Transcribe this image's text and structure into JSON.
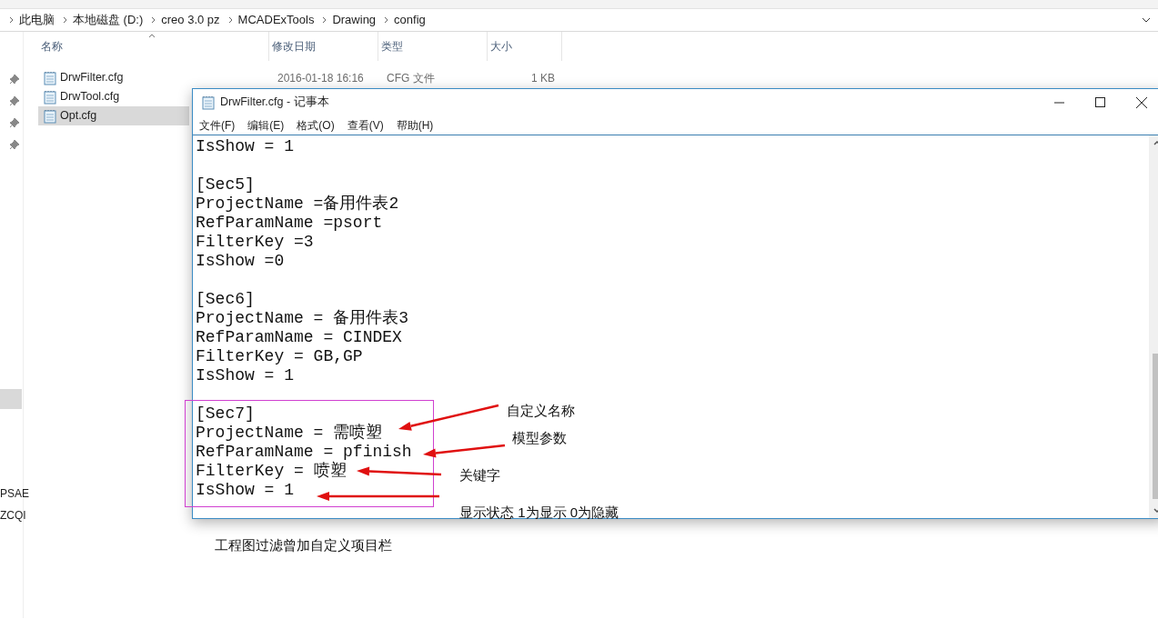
{
  "address_bar": {
    "crumbs": [
      "此电脑",
      "本地磁盘 (D:)",
      "creo 3.0 pz",
      "MCADExTools",
      "Drawing",
      "config"
    ]
  },
  "file_list": {
    "columns": [
      "名称",
      "修改日期",
      "类型",
      "大小"
    ],
    "rows": [
      {
        "name": "DrwFilter.cfg",
        "modified": "2016-01-18 16:16",
        "type": "CFG 文件",
        "size": "1 KB",
        "selected": false
      },
      {
        "name": "DrwTool.cfg",
        "selected": false
      },
      {
        "name": "Opt.cfg",
        "selected": true
      }
    ]
  },
  "nav_pane": {
    "cut_labels": [
      "PSAE",
      "ZCQI"
    ]
  },
  "notepad": {
    "title": "DrwFilter.cfg - 记事本",
    "menu": [
      "文件(F)",
      "编辑(E)",
      "格式(O)",
      "查看(V)",
      "帮助(H)"
    ],
    "sections": [
      [
        "IsShow = 1"
      ],
      [
        "[Sec5]",
        "ProjectName =备用件表2",
        "RefParamName =psort",
        "FilterKey =3",
        "IsShow =0"
      ],
      [
        "[Sec6]",
        "ProjectName = 备用件表3",
        "RefParamName = CINDEX",
        "FilterKey = GB,GP",
        "IsShow = 1"
      ],
      [
        "[Sec7]",
        "ProjectName = 需喷塑",
        "RefParamName = pfinish",
        "FilterKey = 喷塑",
        "IsShow = 1"
      ]
    ]
  },
  "annotations": [
    "自定义名称",
    "模型参数",
    "关键字",
    "显示状态 1为显示 0为隐藏"
  ],
  "caption": "工程图过滤曾加自定义项目栏"
}
